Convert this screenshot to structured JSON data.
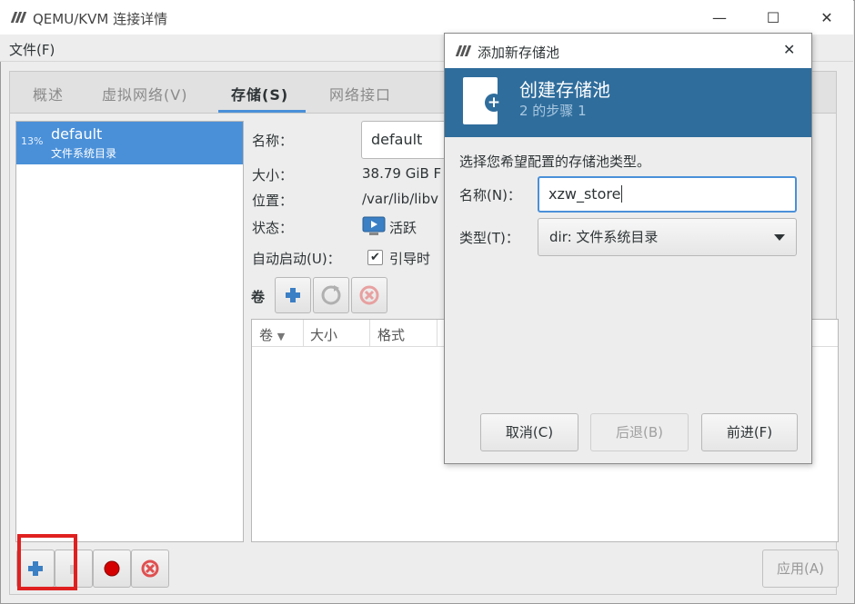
{
  "window": {
    "title": "QEMU/KVM 连接详情",
    "controls": {
      "minimize": "—",
      "maximize": "☐",
      "close": "✕"
    }
  },
  "menubar": {
    "file": "文件(F)"
  },
  "tabs": [
    {
      "label": "概述"
    },
    {
      "label": "虚拟网络(V)"
    },
    {
      "label": "存储(S)"
    },
    {
      "label": "网络接口"
    }
  ],
  "active_tab": "存储(S)",
  "pool_list": [
    {
      "usage": "13%",
      "name": "default",
      "type": "文件系统目录"
    }
  ],
  "details": {
    "name_label": "名称：",
    "name_value": "default",
    "size_label": "大小：",
    "size_value": "38.79 GiB F",
    "location_label": "位置：",
    "location_value": "/var/lib/libv",
    "state_label": "状态：",
    "state_value": "活跃",
    "autostart_label": "自动启动(U)：",
    "autostart_value": "引导时",
    "autostart_checked": true
  },
  "volumes": {
    "label": "卷",
    "columns": [
      "卷",
      "大小",
      "格式"
    ]
  },
  "bottom": {
    "apply_label": "应用(A)"
  },
  "dialog": {
    "title": "添加新存储池",
    "close": "✕",
    "banner_title": "创建存储池",
    "banner_subtitle": "2 的步骤 1",
    "instruction": "选择您希望配置的存储池类型。",
    "name_label": "名称(N)：",
    "name_value": "xzw_store",
    "type_label": "类型(T)：",
    "type_value": "dir: 文件系统目录",
    "cancel": "取消(C)",
    "back": "后退(B)",
    "forward": "前进(F)"
  },
  "colors": {
    "accent": "#4a90d9",
    "banner": "#2f6d9c",
    "highlight_box": "#e02020",
    "record": "#d40000",
    "delete": "#e05050"
  }
}
